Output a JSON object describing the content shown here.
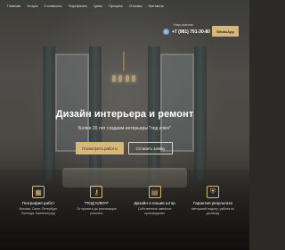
{
  "header": {
    "nav": [
      "Главная",
      "Услуги",
      "Стоимость",
      "Портфолио",
      "Цены",
      "Процесс",
      "Отзывы",
      "Контакты"
    ],
    "contacts_label": "Наш ватсап",
    "phone": "+7 (981) 791-30-80",
    "phone_icon": "phone-icon",
    "whatsapp_label": "WhatsApp"
  },
  "hero": {
    "title": "Дизайн интерьера и ремонт",
    "subtitle": "Более 20 лет создаем интерьеры \"под ключ\"",
    "primary_button": "Посмотреть работы",
    "secondary_button": "Оставить заявку"
  },
  "features": [
    {
      "icon": "building-icon",
      "title": "География работ",
      "desc": "Москва, Санкт-Петербург, Вологда, Калининград"
    },
    {
      "icon": "key-icon",
      "title": "\"ПОД КЛЮЧ\"",
      "desc": "От проекта до реализации ремонта"
    },
    {
      "icon": "furniture-icon",
      "title": "Дизайн и пошив штор",
      "desc": "Собственное швейное производство"
    },
    {
      "icon": "shield-icon",
      "title": "Гарантия результата",
      "desc": "Авторский надзор, работа по договору"
    }
  ]
}
